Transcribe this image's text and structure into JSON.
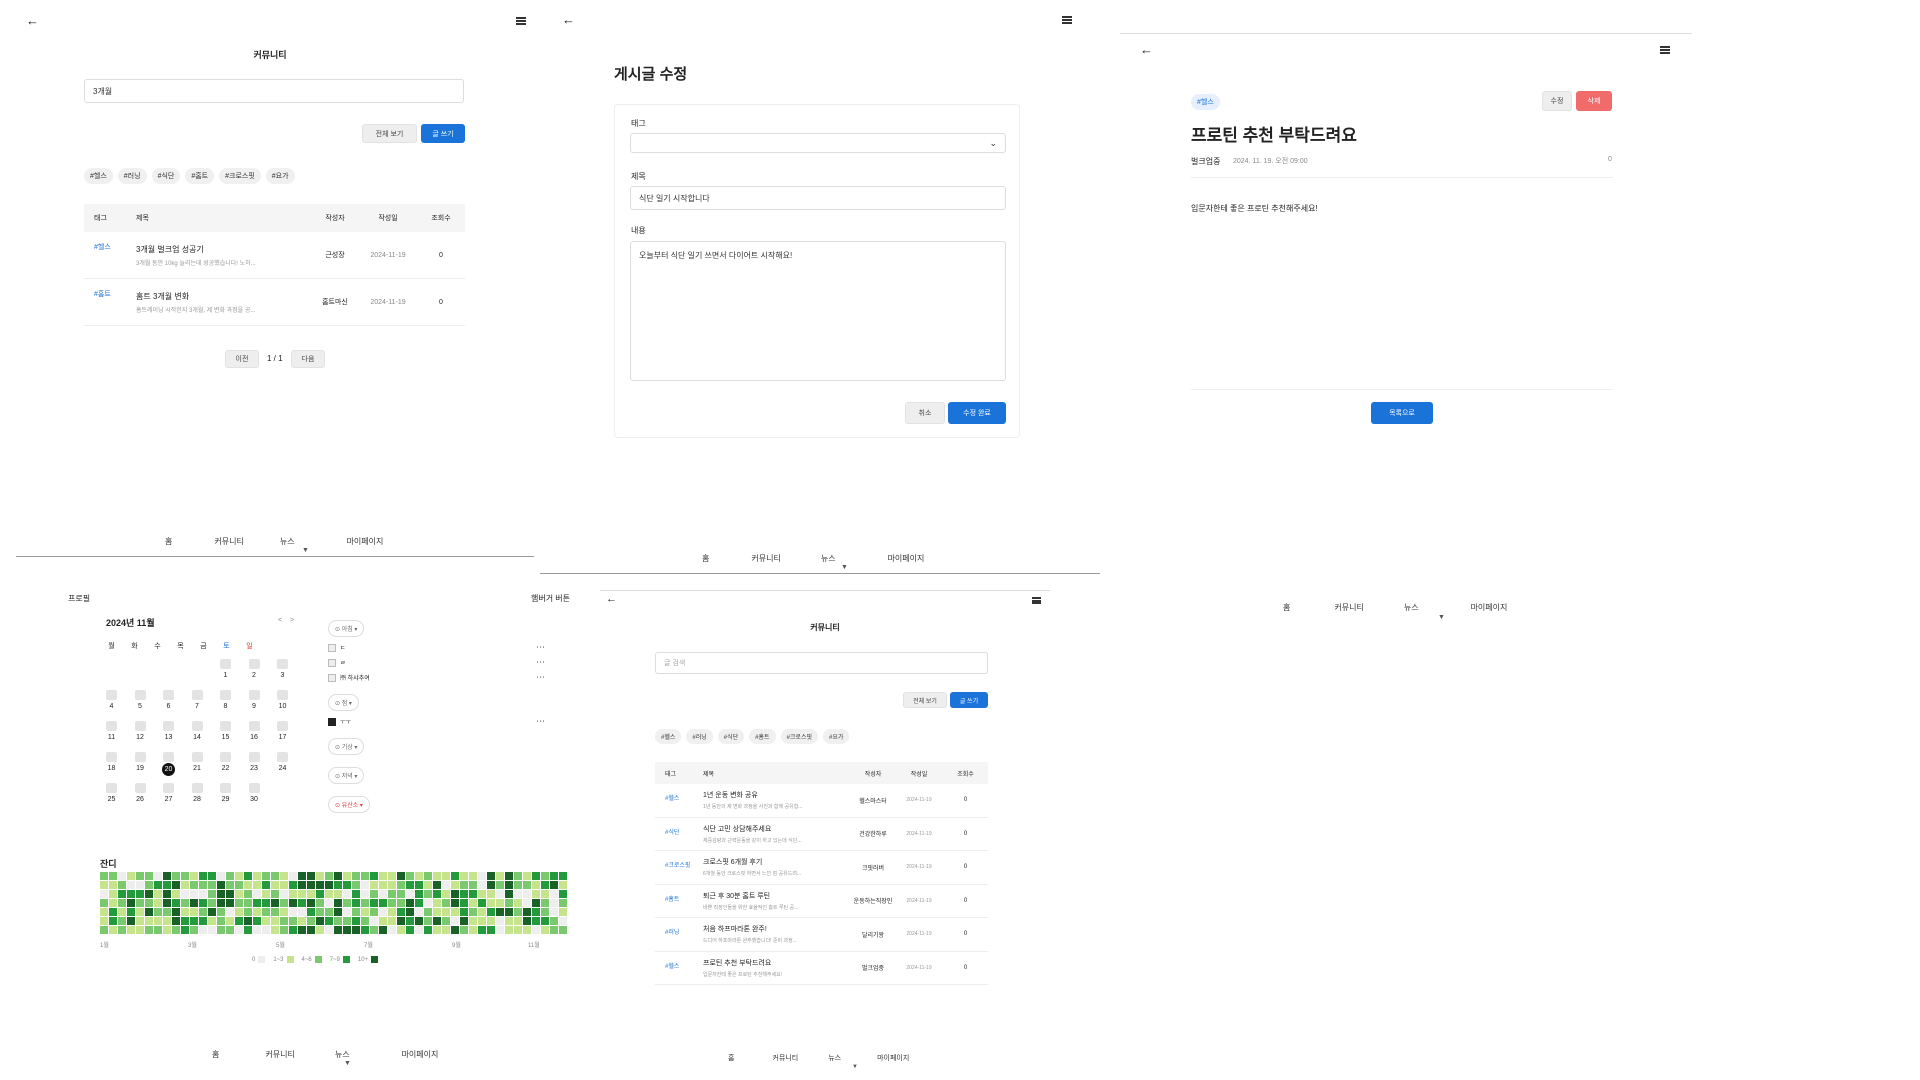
{
  "panel1": {
    "title": "커뮤니티",
    "search_value": "3개월",
    "all_btn": "전체 보기",
    "write_btn": "글 쓰기",
    "tags": [
      "#헬스",
      "#러닝",
      "#식단",
      "#홈트",
      "#크로스핏",
      "#요가"
    ],
    "headers": [
      "태그",
      "제목",
      "작성자",
      "작성일",
      "조회수"
    ],
    "rows": [
      {
        "tag": "#헬스",
        "title": "3개월 벌크업 성공기",
        "snippet": "3개월 동안 10kg 늘리는데 성공했습니다! 노하...",
        "author": "근성장",
        "date": "2024-11-19",
        "views": "0"
      },
      {
        "tag": "#홈트",
        "title": "홈트 3개월 변화",
        "snippet": "홈트레이닝 시작한지 3개월, 제 변화 과정을 공...",
        "author": "홈트마신",
        "date": "2024-11-19",
        "views": "0"
      }
    ],
    "prev": "이전",
    "page": "1 / 1",
    "next": "다음"
  },
  "panel2": {
    "title": "게시글 수정",
    "tag_label": "태그",
    "title_label": "제목",
    "title_value": "식단 일기 시작합니다",
    "content_label": "내용",
    "content_value": "오늘부터 식단 일기 쓰면서 다이어트 시작해요!",
    "cancel": "취소",
    "submit": "수정 완료"
  },
  "panel3": {
    "tag": "#헬스",
    "edit": "수정",
    "delete": "삭제",
    "title": "프로틴 추천 부탁드려요",
    "author": "벌크업중",
    "datetime": "2024. 11. 19. 오전 09:00",
    "views": "0",
    "body": "입문자한테 좋은 프로틴 추천해주세요!",
    "list_btn": "목록으로"
  },
  "nav": {
    "home": "홈",
    "community": "커뮤니티",
    "news": "뉴스",
    "mypage": "마이페이지"
  },
  "profile": {
    "label": "프로필",
    "hamburger_btn": "햄버거 버튼",
    "month": "2024년 11월",
    "weekdays": [
      "월",
      "화",
      "수",
      "목",
      "금",
      "토",
      "일"
    ],
    "days": [
      "",
      "",
      "",
      "",
      "1",
      "2",
      "3",
      "4",
      "5",
      "6",
      "7",
      "8",
      "9",
      "10",
      "11",
      "12",
      "13",
      "14",
      "15",
      "16",
      "17",
      "18",
      "19",
      "20",
      "21",
      "22",
      "23",
      "24",
      "25",
      "26",
      "27",
      "28",
      "29",
      "30",
      ""
    ],
    "selected_day": "20",
    "groups": [
      {
        "pill": "⊙ 아침 ▾",
        "items": [
          "ㄷ",
          "ㄹ",
          "㈜ 하샤추여"
        ]
      },
      {
        "pill": "⊙ 점 ▾",
        "items": [
          "ㅜㅜ"
        ]
      },
      {
        "pill": "⊙ 기상 ▾",
        "items": []
      },
      {
        "pill": "⊙ 저녁 ▾",
        "items": []
      },
      {
        "pill": "⊙ 유산소 ▾",
        "items": []
      }
    ],
    "grass_title": "잔디",
    "months": [
      "1월",
      "3월",
      "5월",
      "7월",
      "9월",
      "11월"
    ],
    "legend": [
      "0",
      "1~3",
      "4~6",
      "7~9",
      "10+"
    ]
  },
  "panel5": {
    "title": "커뮤니티",
    "search_placeholder": "글 검색",
    "all_btn": "전체 보기",
    "write_btn": "글 쓰기",
    "tags": [
      "#헬스",
      "#러닝",
      "#식단",
      "#홈트",
      "#크로스핏",
      "#요가"
    ],
    "headers": [
      "태그",
      "제목",
      "작성자",
      "작성일",
      "조회수"
    ],
    "rows": [
      {
        "tag": "#헬스",
        "title": "1년 운동 변화 공유",
        "snippet": "1년 동안의 제 변화 과정을 사진과 함께 공유합...",
        "author": "헬스마스터",
        "date": "2024-11-19",
        "views": "0"
      },
      {
        "tag": "#식단",
        "title": "식단 고민 상담해주세요",
        "snippet": "체중감량과 근력운동을 같이 하고 있는데 식단...",
        "author": "건강한하루",
        "date": "2024-11-19",
        "views": "0"
      },
      {
        "tag": "#크로스핏",
        "title": "크로스핏 6개월 후기",
        "snippet": "6개월 동안 크로스핏 하면서 느낀 점 공유드려...",
        "author": "크핏러버",
        "date": "2024-11-19",
        "views": "0"
      },
      {
        "tag": "#홈트",
        "title": "퇴근 후 30분 홈트 루틴",
        "snippet": "바쁜 직장인들을 위한 효율적인 홈트 루틴 공...",
        "author": "운동하는직장인",
        "date": "2024-11-19",
        "views": "0"
      },
      {
        "tag": "#러닝",
        "title": "처음 하프마라톤 완주!",
        "snippet": "드디어 하프마라톤 완주했습니다! 준비 과정...",
        "author": "달리기왕",
        "date": "2024-11-19",
        "views": "0"
      },
      {
        "tag": "#헬스",
        "title": "프로틴 추천 부탁드려요",
        "snippet": "입문자한테 좋은 프로틴 추천해주세요!",
        "author": "벌크업중",
        "date": "2024-11-19",
        "views": "0"
      }
    ]
  },
  "colors": {
    "accent": "#1a73d9",
    "danger": "#f26b6b",
    "grass": [
      "#eeeeee",
      "#c6e48b",
      "#7bc96f",
      "#239a3b",
      "#196127"
    ]
  }
}
